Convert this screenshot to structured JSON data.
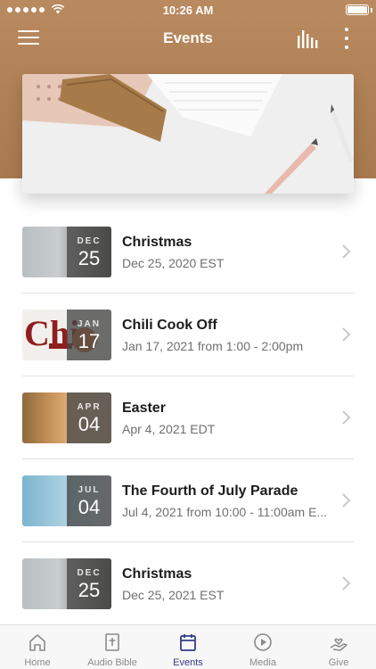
{
  "status_bar": {
    "time": "10:26 AM"
  },
  "nav": {
    "title": "Events"
  },
  "events": [
    {
      "month": "DEC",
      "day": "25",
      "title": "Christmas",
      "subtitle": "Dec 25, 2020 EST"
    },
    {
      "month": "JAN",
      "day": "17",
      "title": "Chili Cook Off",
      "subtitle": "Jan 17, 2021 from 1:00 - 2:00pm"
    },
    {
      "month": "APR",
      "day": "04",
      "title": "Easter",
      "subtitle": "Apr 4, 2021 EDT"
    },
    {
      "month": "JUL",
      "day": "04",
      "title": "The Fourth of July Parade",
      "subtitle": "Jul 4, 2021 from 10:00 - 11:00am E..."
    },
    {
      "month": "DEC",
      "day": "25",
      "title": "Christmas",
      "subtitle": "Dec 25, 2021 EST"
    }
  ],
  "tabs": [
    {
      "label": "Home",
      "icon": "home-icon"
    },
    {
      "label": "Audio Bible",
      "icon": "bible-icon"
    },
    {
      "label": "Events",
      "icon": "calendar-icon",
      "active": true
    },
    {
      "label": "Media",
      "icon": "play-icon"
    },
    {
      "label": "Give",
      "icon": "give-icon"
    }
  ],
  "colors": {
    "header": "#b98a5f",
    "active_tab": "#343c8a"
  }
}
